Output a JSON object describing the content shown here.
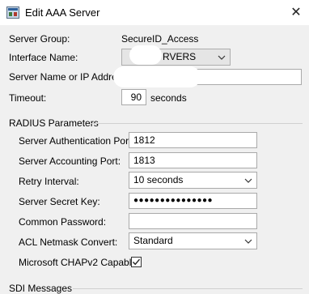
{
  "window": {
    "title": "Edit AAA Server",
    "close_glyph": "✕",
    "icon": "asdm-app-icon"
  },
  "server_group": {
    "label": "Server Group:",
    "value": "SecureID_Access"
  },
  "interface_name": {
    "label": "Interface Name:",
    "value": "RVERS"
  },
  "server_name": {
    "label": "Server Name or IP Address:",
    "value": ""
  },
  "timeout": {
    "label": "Timeout:",
    "value": "90",
    "unit": "seconds"
  },
  "radius": {
    "title": "RADIUS Parameters",
    "auth_port": {
      "label": "Server Authentication Port:",
      "value": "1812"
    },
    "acct_port": {
      "label": "Server Accounting Port:",
      "value": "1813"
    },
    "retry_interval": {
      "label": "Retry Interval:",
      "value": "10 seconds"
    },
    "secret_key": {
      "label": "Server Secret Key:",
      "value": "●●●●●●●●●●●●●●●"
    },
    "common_password": {
      "label": "Common Password:",
      "value": ""
    },
    "acl_netmask": {
      "label": "ACL Netmask Convert:",
      "value": "Standard"
    },
    "chapv2": {
      "label": "Microsoft CHAPv2 Capable:",
      "checked": true
    }
  },
  "sdi": {
    "title": "SDI Messages"
  }
}
